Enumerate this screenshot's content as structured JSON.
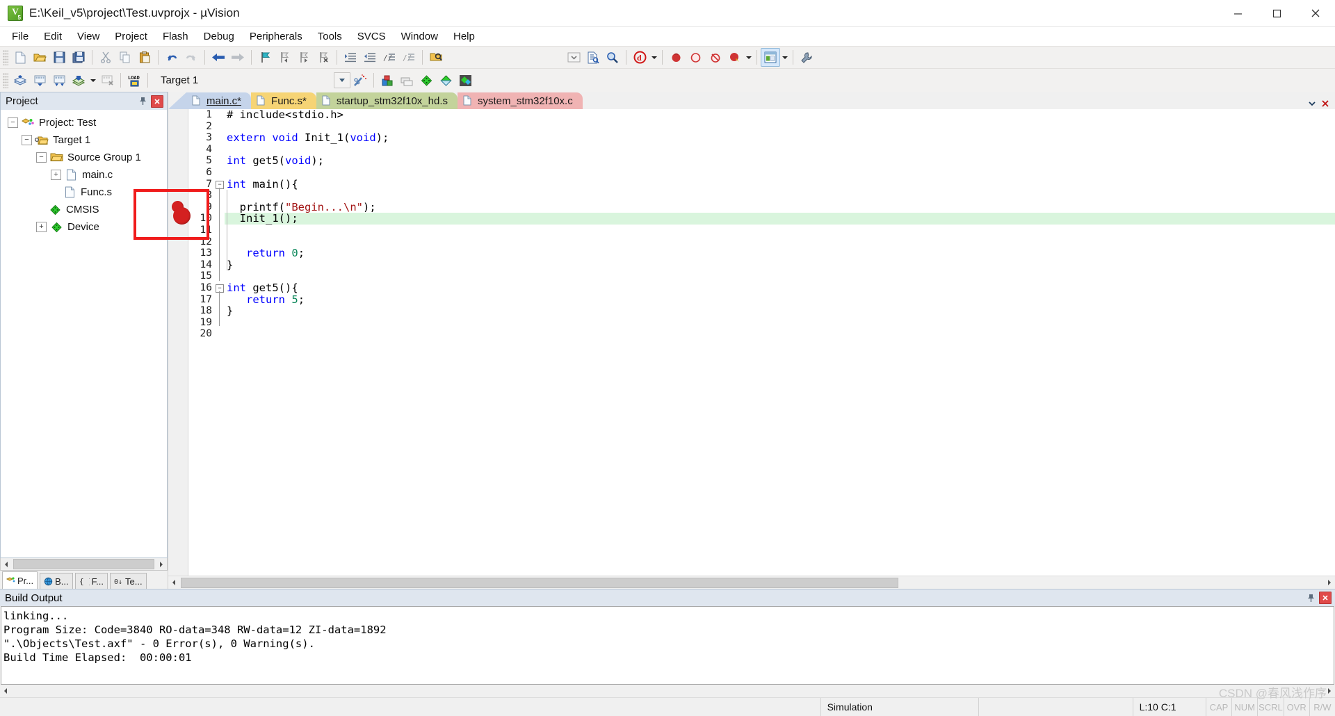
{
  "window": {
    "title": "E:\\Keil_v5\\project\\Test.uvprojx - µVision",
    "app_icon": "keil-uvision-icon",
    "minimize": "minimize-button",
    "maximize": "maximize-button",
    "close": "close-button"
  },
  "menu": {
    "items": [
      {
        "label": "File"
      },
      {
        "label": "Edit"
      },
      {
        "label": "View"
      },
      {
        "label": "Project"
      },
      {
        "label": "Flash"
      },
      {
        "label": "Debug"
      },
      {
        "label": "Peripherals"
      },
      {
        "label": "Tools"
      },
      {
        "label": "SVCS"
      },
      {
        "label": "Window"
      },
      {
        "label": "Help"
      }
    ]
  },
  "toolbar_file": {
    "buttons": [
      {
        "name": "new-file-icon",
        "title": "New"
      },
      {
        "name": "open-file-icon",
        "title": "Open"
      },
      {
        "name": "save-icon",
        "title": "Save"
      },
      {
        "name": "save-all-icon",
        "title": "Save All"
      },
      {
        "name": "cut-icon",
        "title": "Cut"
      },
      {
        "name": "copy-icon",
        "title": "Copy"
      },
      {
        "name": "paste-icon",
        "title": "Paste"
      },
      {
        "name": "undo-icon",
        "title": "Undo"
      },
      {
        "name": "redo-icon",
        "title": "Redo"
      },
      {
        "name": "navigate-back-icon",
        "title": "Back"
      },
      {
        "name": "navigate-forward-icon",
        "title": "Forward"
      },
      {
        "name": "toggle-bookmark-icon",
        "title": "Insert/Remove Bookmark"
      },
      {
        "name": "previous-bookmark-icon",
        "title": "Previous Bookmark"
      },
      {
        "name": "next-bookmark-icon",
        "title": "Next Bookmark"
      },
      {
        "name": "clear-bookmarks-icon",
        "title": "Clear All Bookmarks"
      },
      {
        "name": "indent-icon",
        "title": "Indent"
      },
      {
        "name": "outdent-icon",
        "title": "Outdent"
      },
      {
        "name": "comment-icon",
        "title": "Comment"
      },
      {
        "name": "uncomment-icon",
        "title": "Uncomment"
      },
      {
        "name": "find-in-files-icon",
        "title": "Find in Files"
      }
    ],
    "right_buttons": [
      {
        "name": "configure-toolbar-icon",
        "title": "Configure"
      },
      {
        "name": "source-browse-icon",
        "title": "Source Browse"
      },
      {
        "name": "find-icon",
        "title": "Find"
      },
      {
        "name": "debug-session-icon",
        "title": "Start/Stop Debug Session"
      },
      {
        "name": "insert-breakpoint-icon",
        "title": "Insert/Remove Breakpoint"
      },
      {
        "name": "disable-breakpoint-icon",
        "title": "Enable/Disable Breakpoint"
      },
      {
        "name": "disable-all-breakpoints-icon",
        "title": "Disable All Breakpoints"
      },
      {
        "name": "kill-all-breakpoints-icon",
        "title": "Kill All Breakpoints"
      },
      {
        "name": "manage-windows-icon",
        "title": "Manage Windows"
      },
      {
        "name": "configure-target-icon",
        "title": "Configuration Wizard"
      }
    ]
  },
  "toolbar_build": {
    "buttons": [
      {
        "name": "translate-icon",
        "title": "Translate"
      },
      {
        "name": "build-icon",
        "title": "Build"
      },
      {
        "name": "rebuild-icon",
        "title": "Rebuild"
      },
      {
        "name": "batch-build-icon",
        "title": "Batch Build"
      },
      {
        "name": "stop-build-icon",
        "title": "Stop Build"
      },
      {
        "name": "download-icon",
        "title": "Download",
        "label": "LOAD"
      }
    ],
    "target_combo": {
      "value": "Target 1",
      "name": "target-select"
    },
    "right_buttons": [
      {
        "name": "target-options-icon",
        "title": "Options for Target"
      },
      {
        "name": "magic-wand-icon",
        "title": "Options"
      },
      {
        "name": "manage-project-items-icon",
        "title": "Manage Project Items"
      },
      {
        "name": "multi-project-icon",
        "title": "Multi-Project"
      },
      {
        "name": "pack-installer-icon",
        "title": "Pack Installer"
      },
      {
        "name": "manage-run-time-env-icon",
        "title": "Manage Run-Time Environment"
      },
      {
        "name": "select-software-packs-icon",
        "title": "Select Software Packs"
      }
    ]
  },
  "project_panel": {
    "title": "Project",
    "pin": "pin-icon",
    "close": "close-icon",
    "tree": [
      {
        "label": "Project: Test",
        "depth": 0,
        "expander": "-",
        "icon": "project-icon"
      },
      {
        "label": "Target 1",
        "depth": 1,
        "expander": "-",
        "icon": "target-folder-icon"
      },
      {
        "label": "Source Group 1",
        "depth": 2,
        "expander": "-",
        "icon": "folder-icon"
      },
      {
        "label": "main.c",
        "depth": 3,
        "expander": "+",
        "icon": "c-file-icon"
      },
      {
        "label": "Func.s",
        "depth": 3,
        "expander": "",
        "icon": "asm-file-icon"
      },
      {
        "label": "CMSIS",
        "depth": 2,
        "expander": "",
        "icon": "component-icon"
      },
      {
        "label": "Device",
        "depth": 2,
        "expander": "+",
        "icon": "component-icon"
      }
    ],
    "tabs": [
      {
        "label": "Pr...",
        "icon": "project-tab-icon",
        "selected": true
      },
      {
        "label": "B...",
        "icon": "books-tab-icon",
        "selected": false
      },
      {
        "label": "F...",
        "icon": "functions-tab-icon",
        "selected": false
      },
      {
        "label": "Te...",
        "icon": "templates-tab-icon",
        "selected": false
      }
    ]
  },
  "editor": {
    "tabs": [
      {
        "label": "main.c*",
        "color": "#c5d4ea",
        "selected": true,
        "icon": "c-file-icon"
      },
      {
        "label": "Func.s*",
        "color": "#f6d475",
        "selected": false,
        "icon": "asm-file-icon"
      },
      {
        "label": "startup_stm32f10x_hd.s",
        "color": "#c3d39b",
        "selected": false,
        "icon": "asm-file-icon"
      },
      {
        "label": "system_stm32f10x.c",
        "color": "#f0b3b3",
        "selected": false,
        "icon": "c-file-icon"
      }
    ],
    "tab_nav": [
      {
        "name": "tab-list-chevron-icon"
      },
      {
        "name": "close-tab-icon"
      }
    ],
    "breakpoint_line": 9,
    "highlight_line": 10,
    "lines": [
      {
        "n": 1,
        "tokens": [
          {
            "t": "# include<stdio.h>",
            "c": "pp"
          }
        ]
      },
      {
        "n": 2,
        "tokens": []
      },
      {
        "n": 3,
        "tokens": [
          {
            "t": "extern",
            "c": "kw"
          },
          {
            "t": " ",
            "c": "ident"
          },
          {
            "t": "void",
            "c": "kw"
          },
          {
            "t": " Init_1(",
            "c": "ident"
          },
          {
            "t": "void",
            "c": "kw"
          },
          {
            "t": ");",
            "c": "ident"
          }
        ]
      },
      {
        "n": 4,
        "tokens": []
      },
      {
        "n": 5,
        "tokens": [
          {
            "t": "int",
            "c": "kw"
          },
          {
            "t": " get5(",
            "c": "ident"
          },
          {
            "t": "void",
            "c": "kw"
          },
          {
            "t": ");",
            "c": "ident"
          }
        ]
      },
      {
        "n": 6,
        "tokens": []
      },
      {
        "n": 7,
        "tokens": [
          {
            "t": "int",
            "c": "kw"
          },
          {
            "t": " main(){",
            "c": "ident"
          }
        ],
        "fold": "start"
      },
      {
        "n": 8,
        "tokens": []
      },
      {
        "n": 9,
        "tokens": [
          {
            "t": "  printf(",
            "c": "ident"
          },
          {
            "t": "\"Begin...\\n\"",
            "c": "str"
          },
          {
            "t": ");",
            "c": "ident"
          }
        ]
      },
      {
        "n": 10,
        "tokens": [
          {
            "t": "  Init_1();",
            "c": "ident"
          }
        ],
        "highlight": true
      },
      {
        "n": 11,
        "tokens": []
      },
      {
        "n": 12,
        "tokens": []
      },
      {
        "n": 13,
        "tokens": [
          {
            "t": "   ",
            "c": "ident"
          },
          {
            "t": "return",
            "c": "kw"
          },
          {
            "t": " ",
            "c": "ident"
          },
          {
            "t": "0",
            "c": "num"
          },
          {
            "t": ";",
            "c": "ident"
          }
        ]
      },
      {
        "n": 14,
        "tokens": [
          {
            "t": "}",
            "c": "ident"
          }
        ],
        "fold": "end"
      },
      {
        "n": 15,
        "tokens": []
      },
      {
        "n": 16,
        "tokens": [
          {
            "t": "int",
            "c": "kw"
          },
          {
            "t": " get5(){",
            "c": "ident"
          }
        ],
        "fold": "start"
      },
      {
        "n": 17,
        "tokens": [
          {
            "t": "   ",
            "c": "ident"
          },
          {
            "t": "return",
            "c": "kw"
          },
          {
            "t": " ",
            "c": "ident"
          },
          {
            "t": "5",
            "c": "num"
          },
          {
            "t": ";",
            "c": "ident"
          }
        ]
      },
      {
        "n": 18,
        "tokens": [
          {
            "t": "}",
            "c": "ident"
          }
        ],
        "fold": "end"
      },
      {
        "n": 19,
        "tokens": []
      },
      {
        "n": 20,
        "tokens": []
      }
    ]
  },
  "build_output": {
    "title": "Build Output",
    "pin": "pin-icon",
    "close": "close-icon",
    "lines": [
      "linking...",
      "Program Size: Code=3840 RO-data=348 RW-data=12 ZI-data=1892",
      "\".\\Objects\\Test.axf\" - 0 Error(s), 0 Warning(s).",
      "Build Time Elapsed:  00:00:01"
    ]
  },
  "status_bar": {
    "simulation": "Simulation",
    "position": "L:10 C:1",
    "flags": [
      "CAP",
      "NUM",
      "SCRL",
      "OVR",
      "R/W"
    ]
  },
  "watermark": "CSDN @春风浅作序",
  "colors": {
    "accent": "#dfe6ef",
    "breakpoint": "#d42020",
    "annotation": "#f01b1b",
    "highlight_line": "#d9f5dd",
    "keyword": "#0000ff",
    "string": "#a31515",
    "number": "#098658"
  }
}
